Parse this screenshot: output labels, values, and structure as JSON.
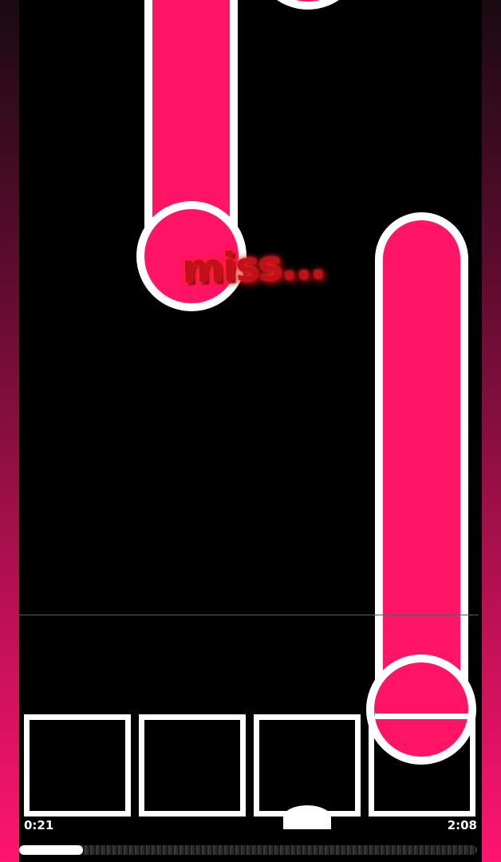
{
  "game": {
    "judgement_text": "miss...",
    "time_elapsed": "0:21",
    "time_total": "2:08",
    "song_progress": 0.14,
    "lane_count": 4
  },
  "colors": {
    "note_fill": "#ff1466",
    "note_outline": "#ffffff",
    "background": "#000000",
    "side_gradient_top": "#1a0a12",
    "side_gradient_bottom": "#ff1470",
    "judge_line": "#5a5a5a",
    "miss_text": "#c0101a"
  },
  "notes": [
    {
      "type": "hold",
      "lane": 1,
      "state": "missed"
    },
    {
      "type": "tap",
      "lane": 2,
      "state": "upcoming"
    },
    {
      "type": "hold",
      "lane": 3,
      "state": "active"
    }
  ],
  "icons": {
    "key_marker": "lane-indicator-arc"
  }
}
